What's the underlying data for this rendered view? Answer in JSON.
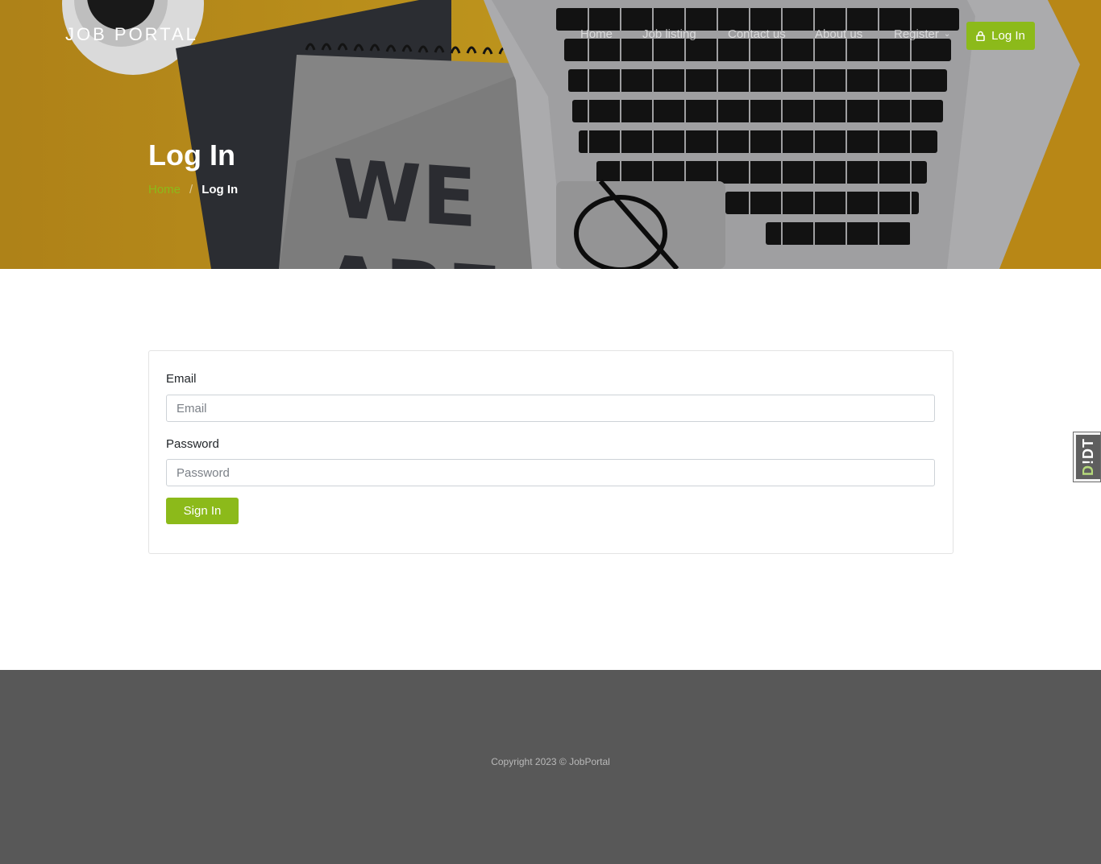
{
  "header": {
    "brand": "JOB PORTAL",
    "nav": {
      "home": "Home",
      "job_listing": "Job listing",
      "contact": "Contact us",
      "about": "About us",
      "register": "Register"
    },
    "login_button": "Log In",
    "accent_color": "#8cba1a"
  },
  "hero": {
    "title": "Log In",
    "notebook_text_1": "WE",
    "notebook_text_2": "ARE",
    "breadcrumb": {
      "home": "Home",
      "separator": "/",
      "current": "Log In"
    }
  },
  "form": {
    "email_label": "Email",
    "email_placeholder": "Email",
    "email_value": "",
    "password_label": "Password",
    "password_placeholder": "Password",
    "password_value": "",
    "submit_label": "Sign In"
  },
  "side_tab": {
    "letter_d": "D",
    "rest": "!DT"
  },
  "footer": {
    "copyright": "Copyright 2023 © JobPortal"
  }
}
